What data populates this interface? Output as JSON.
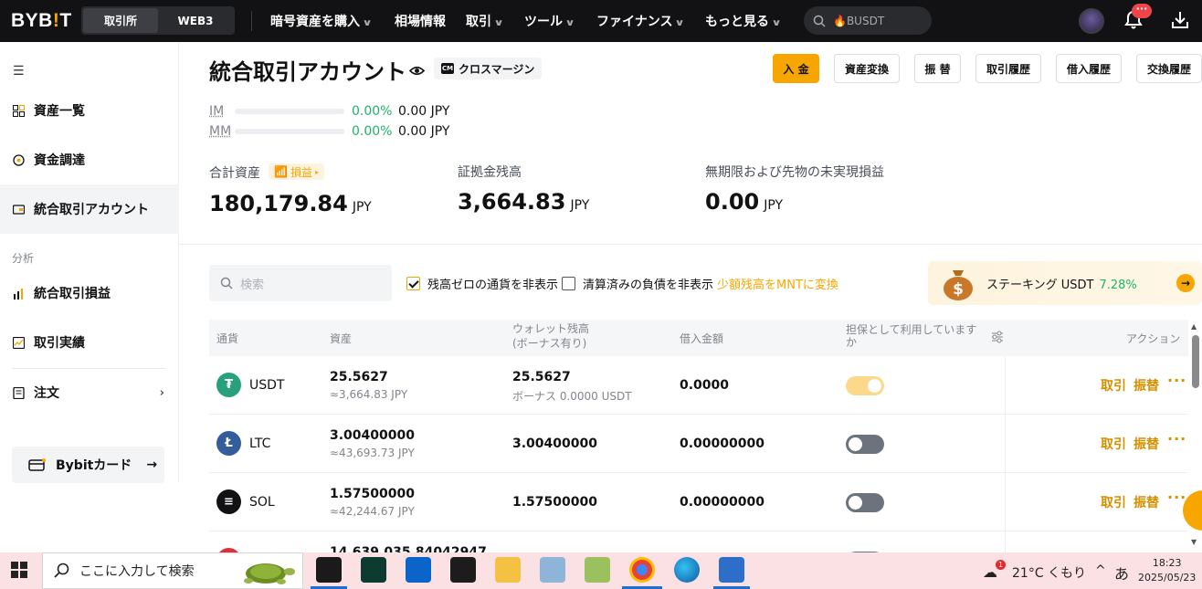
{
  "brand": {
    "logo_main": "BYB",
    "logo_dot": "!",
    "logo_end": "T",
    "accent": "#f7a600"
  },
  "nav": {
    "segments": [
      "取引所",
      "WEB3"
    ],
    "items": [
      "暗号資産を購入",
      "相場情報",
      "取引",
      "ツール",
      "ファイナンス",
      "もっと見る"
    ],
    "search_value": "BUSDT",
    "badge": "···"
  },
  "sidebar": {
    "items": [
      "資産一覧",
      "資金調達",
      "統合取引アカウント"
    ],
    "section_label": "分析",
    "analysis_items": [
      "統合取引損益",
      "取引実績",
      "注文"
    ],
    "card_button": "Bybitカード"
  },
  "header": {
    "title": "統合取引アカウント",
    "margin_mode": "クロスマージン",
    "buttons": [
      "入 金",
      "資産変換",
      "振 替",
      "取引履歴",
      "借入履歴",
      "交換履歴"
    ]
  },
  "margin": {
    "im_label": "IM",
    "im_pct": "0.00%",
    "im_amount": "0.00 JPY",
    "mm_label": "MM",
    "mm_pct": "0.00%",
    "mm_amount": "0.00 JPY"
  },
  "stats": {
    "total_label": "合計資産",
    "pnl_chip": "損益",
    "total_value": "180,179.84",
    "total_unit": "JPY",
    "margin_label": "証拠金残高",
    "margin_value": "3,664.83",
    "margin_unit": "JPY",
    "unrealized_label": "無期限および先物の未実現損益",
    "unrealized_value": "0.00",
    "unrealized_unit": "JPY"
  },
  "filters": {
    "search_placeholder": "検索",
    "hide_zero": "残高ゼロの通貨を非表示",
    "hide_zero_checked": true,
    "hide_liab": "清算済みの負債を非表示",
    "hide_liab_checked": false,
    "convert_link": "少額残高をMNTに変換"
  },
  "staking": {
    "label": "ステーキング USDT",
    "apr": "7.28%"
  },
  "table": {
    "headers": {
      "coin": "通貨",
      "asset": "資産",
      "wallet": "ウォレット残高",
      "wallet_sub": "(ボーナス有り)",
      "borrow": "借入金額",
      "collateral": "担保として利用しています",
      "collateral_tail": "か",
      "action": "アクション"
    },
    "rows": [
      {
        "coin": "USDT",
        "asset": "25.5627",
        "asset_jpy": "≈3,664.83 JPY",
        "wallet": "25.5627",
        "wallet_sub": "ボーナス 0.0000 USDT",
        "borrow": "0.0000",
        "collateral": true,
        "trade": "取引",
        "transfer": "振替",
        "more": "···",
        "color": "#26a17b",
        "symbol": "₮"
      },
      {
        "coin": "LTC",
        "asset": "3.00400000",
        "asset_jpy": "≈43,693.73 JPY",
        "wallet": "3.00400000",
        "wallet_sub": "",
        "borrow": "0.00000000",
        "collateral": false,
        "trade": "取引",
        "transfer": "振替",
        "more": "···",
        "color": "#345d9d",
        "symbol": "Ł"
      },
      {
        "coin": "SOL",
        "asset": "1.57500000",
        "asset_jpy": "≈42,244.67 JPY",
        "wallet": "1.57500000",
        "wallet_sub": "",
        "borrow": "0.00000000",
        "collateral": false,
        "trade": "取引",
        "transfer": "振替",
        "more": "···",
        "color": "#121214",
        "symbol": "≡"
      },
      {
        "coin": "",
        "asset": "14,639,035.84042947",
        "asset_jpy": "",
        "wallet": "",
        "wallet_sub": "",
        "borrow": "",
        "collateral": false,
        "trade": "",
        "transfer": "",
        "more": "",
        "color": "#e0313b",
        "symbol": ""
      }
    ]
  },
  "taskbar": {
    "search_placeholder": "ここに入力して検索",
    "weather": "21°C くもり",
    "weather_badge": "1",
    "ime": "あ",
    "caret": "^",
    "time": "18:23",
    "date": "2025/05/23"
  }
}
